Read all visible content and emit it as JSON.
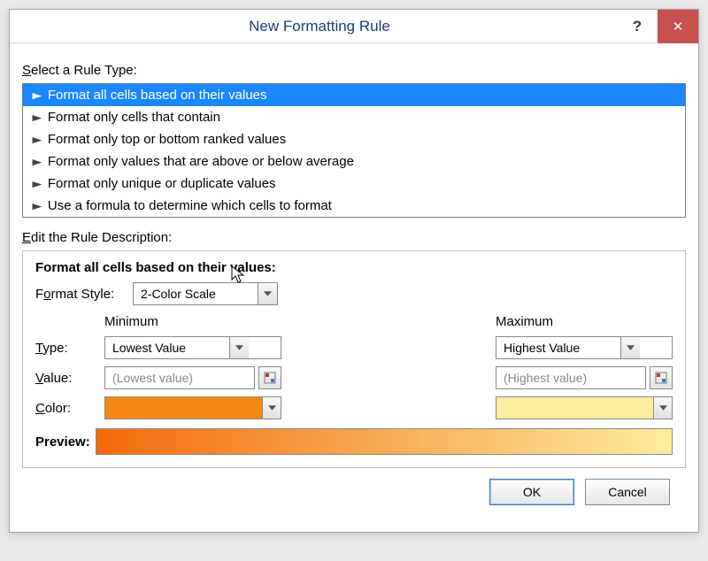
{
  "window": {
    "title": "New Formatting Rule",
    "help": "?",
    "close": "✕"
  },
  "ruleType": {
    "label": "Select a Rule Type:",
    "items": [
      "Format all cells based on their values",
      "Format only cells that contain",
      "Format only top or bottom ranked values",
      "Format only values that are above or below average",
      "Format only unique or duplicate values",
      "Use a formula to determine which cells to format"
    ]
  },
  "descSection": {
    "label": "Edit the Rule Description:",
    "title": "Format all cells based on their values:",
    "formatStyle": {
      "label": "Format Style:",
      "value": "2-Color Scale"
    },
    "columns": {
      "min": "Minimum",
      "max": "Maximum"
    },
    "type": {
      "label": "Type:",
      "min": "Lowest Value",
      "max": "Highest Value"
    },
    "value": {
      "label": "Value:",
      "min": "(Lowest value)",
      "max": "(Highest value)"
    },
    "color": {
      "label": "Color:",
      "min": "#f58a13",
      "max": "#fdec9e"
    },
    "preview": {
      "label": "Preview:",
      "from": "#f26a0c",
      "to": "#fdec9e"
    }
  },
  "footer": {
    "ok": "OK",
    "cancel": "Cancel"
  }
}
